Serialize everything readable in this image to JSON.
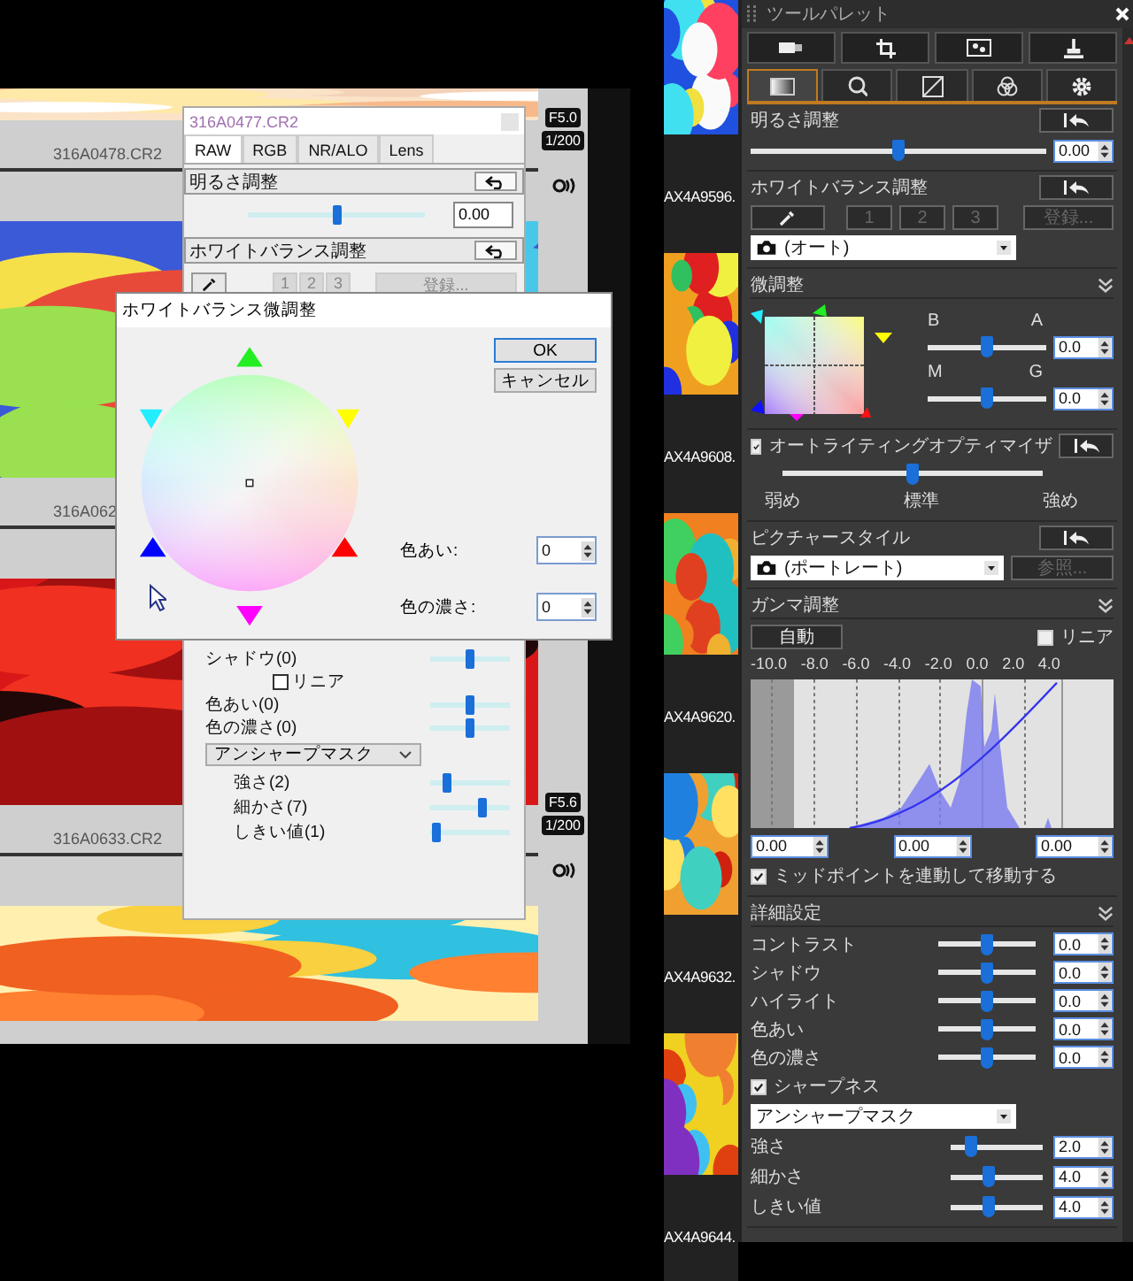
{
  "viewer": {
    "cells": [
      {
        "kind": "picture",
        "filename": "316A0478.CR2",
        "aperture": "F5.0",
        "shutter": "1/200"
      },
      {
        "kind": "picture",
        "filename": "316A062"
      },
      {
        "kind": "picture",
        "filename": "316A0633.CR2",
        "aperture": "F5.6",
        "shutter": "1/200"
      },
      {
        "kind": "picture"
      }
    ]
  },
  "raw_palette": {
    "title": "316A0477.CR2",
    "tabs": [
      {
        "label": "RAW",
        "selected": true
      },
      {
        "label": "RGB",
        "selected": false
      },
      {
        "label": "NR/ALO",
        "selected": false
      },
      {
        "label": "Lens",
        "selected": false
      }
    ],
    "brightness": {
      "label": "明るさ調整",
      "level": 0.5,
      "value": "0.00"
    },
    "white_balance": {
      "label": "ホワイトバランス調整",
      "presets": [
        "1",
        "2",
        "3"
      ],
      "register": "登録..."
    },
    "tone_sliders": [
      {
        "label": "シャドウ(0)",
        "level": 0.5
      }
    ],
    "linear": {
      "label": "リニア",
      "checked": false
    },
    "color_sliders": [
      {
        "label": "色あい(0)",
        "level": 0.5
      },
      {
        "label": "色の濃さ(0)",
        "level": 0.5
      }
    ],
    "sharpen": {
      "mode": "アンシャープマスク",
      "sliders": [
        {
          "label": "強さ(2)",
          "level": 0.2
        },
        {
          "label": "細かさ(7)",
          "level": 0.65
        },
        {
          "label": "しきい値(1)",
          "level": 0.08
        }
      ]
    }
  },
  "wb_dialog": {
    "title": "ホワイトバランス微調整",
    "ok": "OK",
    "cancel": "キャンセル",
    "fields": [
      {
        "label": "色あい:",
        "value": "0"
      },
      {
        "label": "色の濃さ:",
        "value": "0"
      }
    ]
  },
  "filmstrip": [
    {
      "kind": "picture",
      "filename": "AX4A9596."
    },
    {
      "kind": "picture",
      "filename": "AX4A9608."
    },
    {
      "kind": "picture",
      "filename": "AX4A9620."
    },
    {
      "kind": "picture",
      "filename": "AX4A9632."
    },
    {
      "kind": "picture",
      "filename": "AX4A9644."
    }
  ],
  "tool_palette": {
    "title": "ツールパレット",
    "tabs": [
      {
        "selected": true
      },
      {
        "selected": false
      },
      {
        "selected": false
      },
      {
        "selected": false
      },
      {
        "selected": false
      }
    ],
    "brightness": {
      "label": "明るさ調整",
      "level": 0.5,
      "value": "0.00"
    },
    "white_balance": {
      "label": "ホワイトバランス調整",
      "presets": [
        "1",
        "2",
        "3"
      ],
      "register": "登録...",
      "mode": "(オート)"
    },
    "fine_tune": {
      "label": "微調整",
      "sliders": [
        {
          "left": "B",
          "right": "A",
          "level": 0.5,
          "value": "0.0"
        },
        {
          "left": "M",
          "right": "G",
          "level": 0.5,
          "value": "0.0"
        }
      ]
    },
    "auto_lighting": {
      "label": "オートライティングオプティマイザ",
      "checked": true,
      "level": 0.5,
      "marks": [
        "弱め",
        "標準",
        "強め"
      ]
    },
    "picture_style": {
      "label": "ピクチャースタイル",
      "value": "(ポートレート)",
      "browse": "参照..."
    },
    "gamma": {
      "label": "ガンマ調整",
      "auto": "自動",
      "linear": {
        "label": "リニア",
        "checked": false
      },
      "axis_labels": [
        "-10.0",
        "-8.0",
        "-6.0",
        "-4.0",
        "-2.0",
        "0.0",
        "2.0",
        "4.0"
      ],
      "fields": [
        "0.00",
        "0.00",
        "0.00"
      ],
      "link_midpoint": {
        "label": "ミッドポイントを連動して移動する",
        "checked": true
      }
    },
    "detail": {
      "label": "詳細設定",
      "sliders": [
        {
          "label": "コントラスト",
          "level": 0.5,
          "value": "0.0"
        },
        {
          "label": "シャドウ",
          "level": 0.5,
          "value": "0.0"
        },
        {
          "label": "ハイライト",
          "level": 0.5,
          "value": "0.0"
        },
        {
          "label": "色あい",
          "level": 0.5,
          "value": "0.0"
        },
        {
          "label": "色の濃さ",
          "level": 0.5,
          "value": "0.0"
        }
      ]
    },
    "sharpness": {
      "label": "シャープネス",
      "checked": true,
      "mode": "アンシャープマスク",
      "sliders": [
        {
          "label": "強さ",
          "level": 0.22,
          "value": "2.0"
        },
        {
          "label": "細かさ",
          "level": 0.42,
          "value": "4.0"
        },
        {
          "label": "しきい値",
          "level": 0.42,
          "value": "4.0"
        }
      ]
    }
  }
}
